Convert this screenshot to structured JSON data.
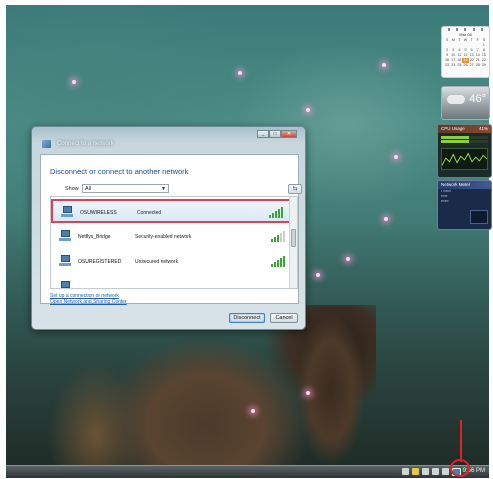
{
  "dialog": {
    "title": "Connect to a network",
    "instruction": "Disconnect or connect to another network",
    "show_label": "Show",
    "show_value": "All",
    "networks": [
      {
        "name": "OSUWIRELESS",
        "status": "Connected",
        "signal": 5,
        "selected": true
      },
      {
        "name": "Netflys_Bridge",
        "status": "Security-enabled network",
        "signal": 3,
        "selected": false
      },
      {
        "name": "OSUREGISTERED",
        "status": "Unsecured network",
        "signal": 5,
        "selected": false
      }
    ],
    "link_setup": "Set up a connection or network",
    "link_center": "Open Network and Sharing Center",
    "disconnect_label": "Disconnect",
    "cancel_label": "Cancel"
  },
  "gadgets": {
    "calendar_month": "Mar 08",
    "weather_temp": "46°",
    "cpu_title": "CPU Usage",
    "cpu_value": "41%",
    "network_title": "Network Meter"
  },
  "taskbar": {
    "clock": "9:56 PM"
  },
  "colors": {
    "annotation": "#e0202a",
    "selection_border": "#d9435a",
    "link": "#1f5fb0"
  }
}
